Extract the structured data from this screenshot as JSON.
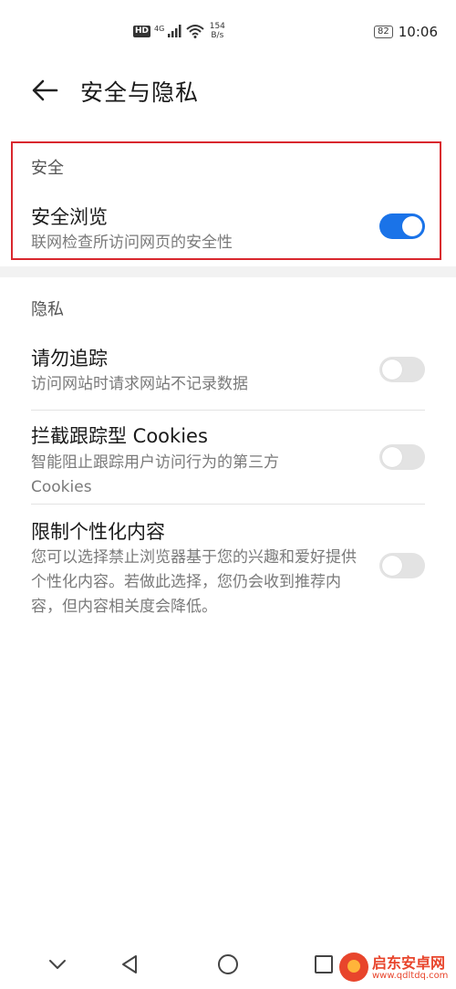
{
  "status_bar": {
    "hd": "HD",
    "network": "4G",
    "speed_value": "154",
    "speed_unit": "B/s",
    "battery": "82",
    "time": "10:06"
  },
  "header": {
    "title": "安全与隐私",
    "back_icon": "arrow-left-icon"
  },
  "security": {
    "section_label": "安全",
    "items": [
      {
        "title": "安全浏览",
        "subtitle": "联网检查所访问网页的安全性",
        "enabled": true
      }
    ]
  },
  "privacy": {
    "section_label": "隐私",
    "items": [
      {
        "title": "请勿追踪",
        "subtitle": "访问网站时请求网站不记录数据",
        "enabled": false
      },
      {
        "title": "拦截跟踪型 Cookies",
        "subtitle": "智能阻止跟踪用户访问行为的第三方 Cookies",
        "enabled": false
      },
      {
        "title": "限制个性化内容",
        "subtitle": "您可以选择禁止浏览器基于您的兴趣和爱好提供个性化内容。若做此选择，您仍会收到推荐内容，但内容相关度会降低。",
        "enabled": false
      }
    ]
  },
  "colors": {
    "toggle_on": "#1a73e8",
    "toggle_off": "#e3e3e3",
    "highlight": "#d9272e"
  },
  "watermark": {
    "name": "启东安卓网",
    "url": "www.qdltdq.com"
  },
  "nav_bar": {
    "icons": [
      "chevron-down-icon",
      "back-triangle-icon",
      "home-circle-icon",
      "recents-square-icon"
    ]
  }
}
